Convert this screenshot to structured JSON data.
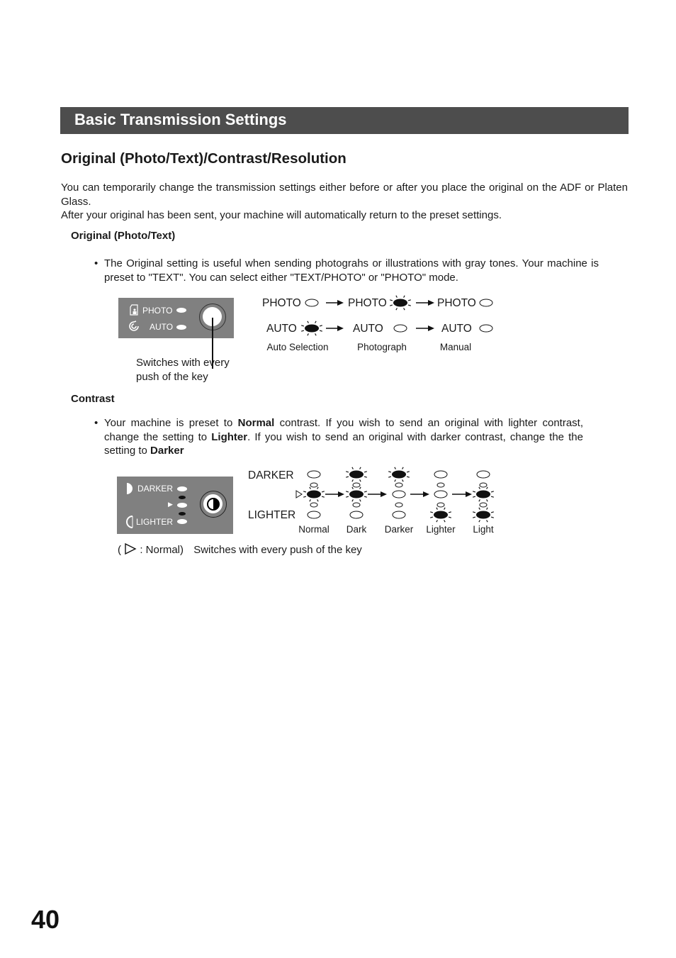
{
  "header": {
    "section_title": "Basic Transmission Settings"
  },
  "page_title": "Original (Photo/Text)/Contrast/Resolution",
  "intro": {
    "line1": "You can temporarily change the transmission settings either before or after you place the original on the ADF or Platen Glass.",
    "line2": "After your original has been sent, your machine will automatically return to the preset settings."
  },
  "original_section": {
    "heading": "Original (Photo/Text)",
    "bullet": "The Original setting is useful when sending photograhs or illustrations with gray tones. Your machine is preset to \"TEXT\". You can select either \"TEXT/PHOTO\" or \"PHOTO\" mode.",
    "panel": {
      "photo_label": "PHOTO",
      "auto_label": "AUTO",
      "icons": [
        "photo-document-icon",
        "auto-swirl-icon"
      ]
    },
    "callout": "Switches with every push of the key",
    "states": [
      {
        "photo_label": "PHOTO",
        "auto_label": "AUTO",
        "photo_lit": false,
        "auto_lit": true,
        "caption": "Auto Selection"
      },
      {
        "photo_label": "PHOTO",
        "auto_label": "AUTO",
        "photo_lit": true,
        "auto_lit": false,
        "caption": "Photograph"
      },
      {
        "photo_label": "PHOTO",
        "auto_label": "AUTO",
        "photo_lit": false,
        "auto_lit": false,
        "caption": "Manual"
      }
    ]
  },
  "contrast_section": {
    "heading": "Contrast",
    "bullet_parts": {
      "a": "Your machine is preset to ",
      "b": "Normal",
      "c": " contrast. If you wish to send an original with lighter contrast, change the setting to ",
      "d": "Lighter",
      "e": ". If you wish to send an original with darker contrast, change the the setting to ",
      "f": "Darker"
    },
    "panel": {
      "darker_label": "DARKER",
      "lighter_label": "LIGHTER",
      "icons": [
        "darker-half-moon-icon",
        "lighter-half-moon-icon",
        "contrast-key-icon"
      ]
    },
    "darker_label": "DARKER",
    "lighter_label": "LIGHTER",
    "states": [
      {
        "caption": "Normal",
        "lit": [
          false,
          true,
          false
        ]
      },
      {
        "caption": "Dark",
        "lit": [
          true,
          true,
          false
        ]
      },
      {
        "caption": "Darker",
        "lit": [
          true,
          false,
          false
        ]
      },
      {
        "caption": "Lighter",
        "lit": [
          false,
          false,
          true
        ]
      },
      {
        "caption": "Light",
        "lit": [
          false,
          true,
          true
        ]
      }
    ],
    "legend_open": "(",
    "legend_normal": ": Normal)",
    "legend_switch": "Switches with every push of the key"
  },
  "page_number": "40"
}
